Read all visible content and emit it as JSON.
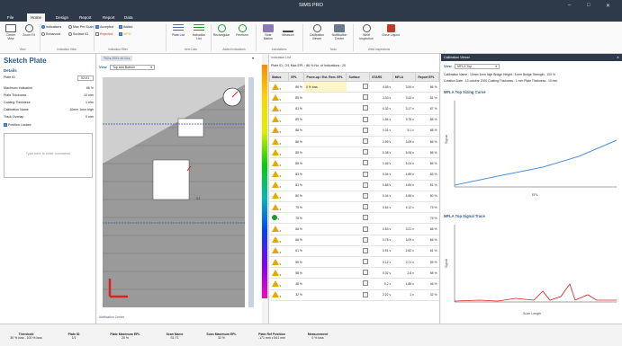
{
  "app": {
    "title": "SIMS PRO"
  },
  "tabs": [
    "File",
    "Home",
    "Design",
    "Report",
    "Report",
    "Data"
  ],
  "ribbon": {
    "buttons": [
      "Center View",
      "Zoom Fit",
      "Plate List",
      "Indication List",
      "Rectangular",
      "Freeform",
      "Note Marker",
      "Measure",
      "Calibration Viewer",
      "Notification Center",
      "Weld Inspection",
      "Close Layout"
    ],
    "radios": [
      "Indications",
      "Max Per Scan",
      "Enhanced",
      "Surface ID"
    ],
    "checks": [
      "Accepted",
      "Added",
      "Rejected",
      "WFM"
    ],
    "groups": [
      "View",
      "Indication View",
      "Indication Filter",
      "Item Lists",
      "Added Indications",
      "Annotations",
      "Tools",
      "Weld Inspections"
    ]
  },
  "left": {
    "title": "Sketch Plate",
    "section": "Details",
    "fields": [
      {
        "k": "Plate ID",
        "v": "02-01"
      },
      {
        "k": "Maximum Indication",
        "v": "86 %"
      },
      {
        "k": "Plate Thickness",
        "v": "10 mm"
      },
      {
        "k": "Coating Thickness",
        "v": "1 mm"
      },
      {
        "k": "Calibration Name",
        "v": "10mm 1mm high"
      },
      {
        "k": "Track Overlap",
        "v": "0 mm"
      }
    ],
    "position_locked": "Position Locked",
    "comments_placeholder": "Type here to enter comments"
  },
  "center": {
    "view_label": "View",
    "view_value": "Top and Bottom",
    "plate_label": "T02 ▸ 2021-10-14 ▸",
    "notif": "Notification Center",
    "plate_tag": "01"
  },
  "grid": {
    "header": "Indication List",
    "info": "Plate ID : 2/1      Max EPL : 86 %      No. of Indications : 20",
    "columns": [
      "Status",
      "EPL",
      "Prove-up / Est. Rem. EPL",
      "Surface",
      "STARS",
      "MFLA",
      "Report EPL"
    ],
    "rows": [
      {
        "s": "tri",
        "epl": "86 %",
        "pu": "0 % loss",
        "st": "4.45 v",
        "mf": "3.54 v",
        "r": "86 %"
      },
      {
        "s": "tri",
        "epl": "85 %",
        "pu": "",
        "st": "3.33 v",
        "mf": "3.43 v",
        "r": "81 %"
      },
      {
        "s": "tri",
        "epl": "81 %",
        "pu": "",
        "st": "0.32 v",
        "mf": "3.17 v",
        "r": "87 %"
      },
      {
        "s": "tri",
        "epl": "89 %",
        "pu": "",
        "st": "1.54 v",
        "mf": "5.75 v",
        "r": "88 %"
      },
      {
        "s": "tri",
        "epl": "88 %",
        "pu": "",
        "st": "0.31 v",
        "mf": "5.1 v",
        "r": "88 %"
      },
      {
        "s": "tri",
        "epl": "86 %",
        "pu": "",
        "st": "2.99 v",
        "mf": "3.09 v",
        "r": "86 %"
      },
      {
        "s": "tri",
        "epl": "85 %",
        "pu": "",
        "st": "0.38 v",
        "mf": "5.06 v",
        "r": "85 %"
      },
      {
        "s": "tri",
        "epl": "85 %",
        "pu": "",
        "st": "1.46 v",
        "mf": "5.04 v",
        "r": "85 %"
      },
      {
        "s": "tri",
        "epl": "83 %",
        "pu": "",
        "st": "0.34 v",
        "mf": "4.89 v",
        "r": "83 %"
      },
      {
        "s": "tri",
        "epl": "81 %",
        "pu": "",
        "st": "0.68 v",
        "mf": "4.84 v",
        "r": "81 %"
      },
      {
        "s": "tri",
        "epl": "80 %",
        "pu": "",
        "st": "0.44 v",
        "mf": "4.55 v",
        "r": "80 %"
      },
      {
        "s": "tri",
        "epl": "75 %",
        "pu": "",
        "st": "0.64 v",
        "mf": "4.12 v",
        "r": "75 %"
      },
      {
        "s": "dot",
        "epl": "75 %",
        "pu": "",
        "st": "",
        "mf": "",
        "r": "75 %"
      },
      {
        "s": "tri",
        "epl": "68 %",
        "pu": "",
        "st": "0.53 v",
        "mf": "3.21 v",
        "r": "68 %"
      },
      {
        "s": "tri",
        "epl": "66 %",
        "pu": "",
        "st": "0.78 v",
        "mf": "3.09 v",
        "r": "66 %"
      },
      {
        "s": "tri",
        "epl": "61 %",
        "pu": "",
        "st": "0.91 v",
        "mf": "2.82 v",
        "r": "61 %"
      },
      {
        "s": "tri",
        "epl": "59 %",
        "pu": "",
        "st": "0.12 v",
        "mf": "2.71 v",
        "r": "59 %"
      },
      {
        "s": "tri",
        "epl": "58 %",
        "pu": "",
        "st": "0.02 v",
        "mf": "2.6 v",
        "r": "58 %"
      },
      {
        "s": "tri",
        "epl": "46 %",
        "pu": "",
        "st": "0.2 v",
        "mf": "1.85 v",
        "r": "46 %"
      },
      {
        "s": "tri",
        "epl": "32 %",
        "pu": "",
        "st": "2.22 v",
        "mf": "1 v",
        "r": "32 %"
      }
    ]
  },
  "right": {
    "header": "Calibration Viewer",
    "view_label": "View",
    "view_value": "MFLA Top",
    "info1": "Calibration Name : 10mm 1mm high   Bridge Height : 8 mm   Bridge Strength : 100 %",
    "info2": "Creation Date : 13 octobre 2020   Coating Thickness : 1 mm   Plate Thickness : 10 mm",
    "chart1_title": "MFLA Top Sizing Curve",
    "chart1_x": "EPL",
    "chart1_y": "Signal",
    "chart2_title": "MFLA Top Signal Trace",
    "chart2_x": "Scan Length",
    "chart2_y": "Signal"
  },
  "status": [
    {
      "k": "Threshold",
      "v": "30 % loss - 100 % loss"
    },
    {
      "k": "Plate ID",
      "v": "1/1"
    },
    {
      "k": "Plate Maximum EPL",
      "v": "20 %"
    },
    {
      "k": "Scan Name",
      "v": "S1 T1"
    },
    {
      "k": "Scan Maximum EPL",
      "v": "32 %"
    },
    {
      "k": "Plate Ref Position",
      "v": "-171 mm x 541 mm"
    },
    {
      "k": "Measurement",
      "v": "0 % loss"
    }
  ],
  "colors": {
    "accent": "#2e3a4a",
    "warn": "#e8a600",
    "ok": "#1a9b2c",
    "curve": "#4d8fe0",
    "trace": "#d62020"
  }
}
